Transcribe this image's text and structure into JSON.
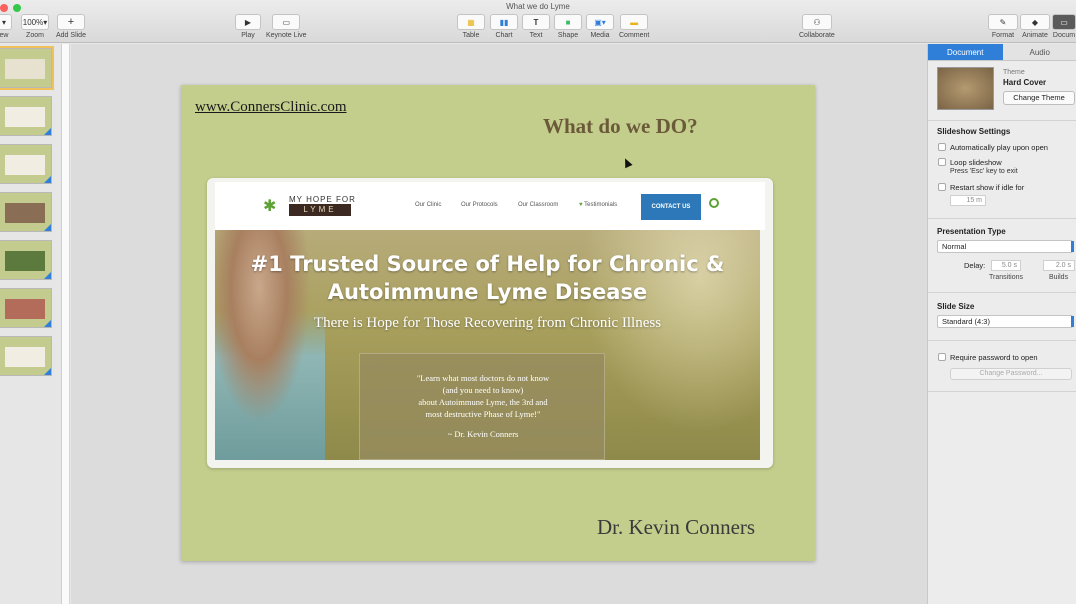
{
  "window": {
    "title": "What we do Lyme"
  },
  "toolbar": {
    "view_label": "ew",
    "zoom_value": "100%",
    "zoom_label": "Zoom",
    "add_slide_label": "Add Slide",
    "play_label": "Play",
    "keynote_live_label": "Keynote Live",
    "table_label": "Table",
    "chart_label": "Chart",
    "text_label": "Text",
    "shape_label": "Shape",
    "media_label": "Media",
    "comment_label": "Comment",
    "collaborate_label": "Collaborate",
    "format_label": "Format",
    "animate_label": "Animate",
    "document_label": "Docum"
  },
  "slide": {
    "url_text": "www.ConnersClinic.com",
    "title": "What do we DO?",
    "author": "Dr. Kevin Conners",
    "site": {
      "logo_top": "MY HOPE FOR",
      "logo_bottom": "LYME",
      "nav": [
        "Our Clinic",
        "Our Protocols",
        "Our Classroom",
        "Testimonials"
      ],
      "contact": "CONTACT US",
      "hero_title": "#1 Trusted Source of Help for Chronic & Autoimmune Lyme Disease",
      "hero_sub": "There is Hope for Those Recovering from Chronic Illness",
      "quote": "\"Learn what most doctors do not know\n(and you need to know)\nabout Autoimmune Lyme, the 3rd and\nmost destructive Phase of Lyme!\"",
      "quote_attr": "~ Dr. Kevin Conners"
    }
  },
  "inspector": {
    "tabs": [
      "Document",
      "Audio"
    ],
    "theme_label": "Theme",
    "theme_name": "Hard Cover",
    "change_theme": "Change Theme",
    "slideshow_heading": "Slideshow Settings",
    "auto_play": "Automatically play upon open",
    "loop": "Loop slideshow",
    "loop_hint": "Press 'Esc' key to exit",
    "restart": "Restart show if idle for",
    "idle_value": "15 m",
    "presentation_heading": "Presentation Type",
    "presentation_value": "Normal",
    "delay_label": "Delay:",
    "transitions_value": "5.0 s",
    "builds_value": "2.0 s",
    "transitions_label": "Transitions",
    "builds_label": "Builds",
    "slide_size_heading": "Slide Size",
    "slide_size_value": "Standard (4:3)",
    "require_password": "Require password to open",
    "change_password": "Change Password..."
  }
}
